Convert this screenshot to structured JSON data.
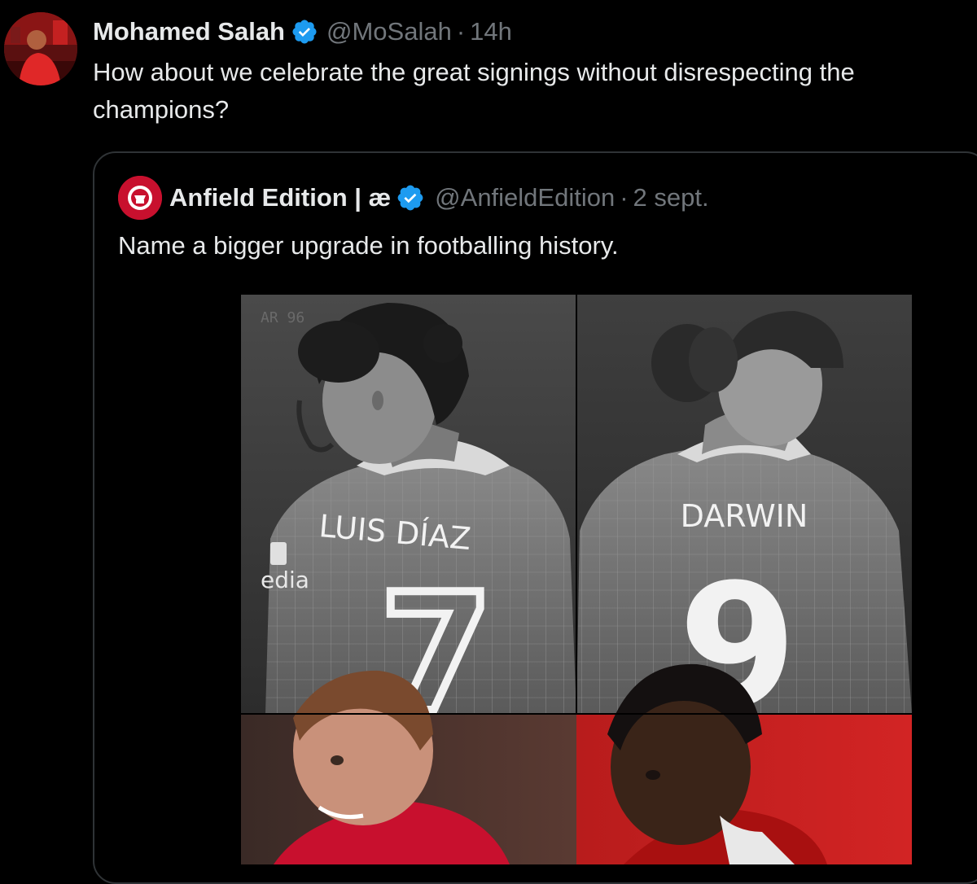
{
  "tweet": {
    "author": {
      "display_name": "Mohamed Salah",
      "handle": "@MoSalah",
      "verified_icon": "verified-badge-icon"
    },
    "separator": "·",
    "time": "14h",
    "text": "How about we celebrate the great signings without disrespecting the champions?"
  },
  "quoted_tweet": {
    "author": {
      "display_name": "Anfield Edition | æ",
      "handle": "@AnfieldEdition",
      "verified_icon": "verified-badge-icon"
    },
    "separator": "·",
    "time": "2 sept.",
    "text": "Name a bigger upgrade in footballing history.",
    "media": {
      "watermark": "AR 96",
      "sponsor_text": "edia",
      "players": [
        {
          "name": "LUIS DÍAZ",
          "number": "7"
        },
        {
          "name": "DARWIN",
          "number": "9"
        }
      ]
    }
  },
  "colors": {
    "background": "#000000",
    "text_primary": "#e7e9ea",
    "text_secondary": "#71767b",
    "border": "#2f3336",
    "verified_blue": "#1d9bf0",
    "brand_red": "#c8102e"
  }
}
